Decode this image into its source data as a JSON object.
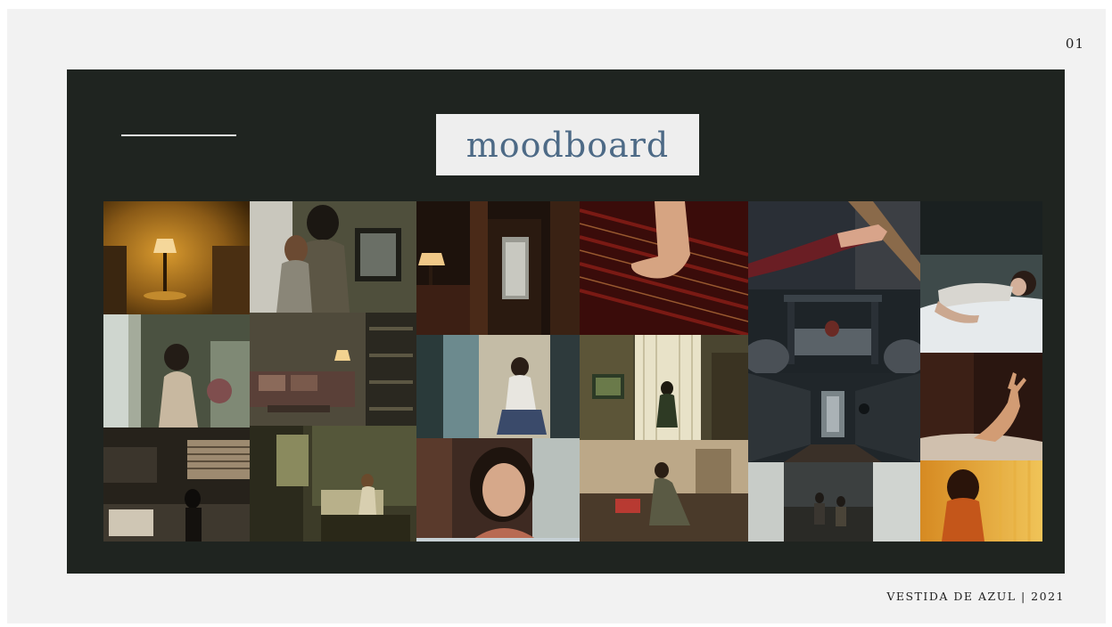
{
  "slide": {
    "page_number": "01",
    "title": "moodboard",
    "footer": "VESTIDA DE AZUL | 2021"
  },
  "colors": {
    "panel": "#1f2420",
    "title_text": "#4d6a86",
    "title_box": "#eeeeee",
    "slide_bg": "#f2f2f2"
  }
}
